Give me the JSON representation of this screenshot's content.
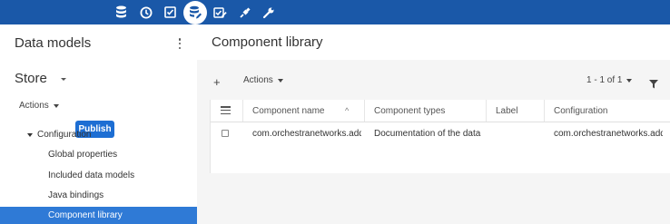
{
  "topbar": {
    "icons": [
      "database-icon",
      "history-icon",
      "checklist-icon",
      "data-model-icon",
      "review-icon",
      "plugin-icon",
      "wrench-icon"
    ],
    "active_icon": "data-model-icon",
    "color": "#1a58a8"
  },
  "sidebar": {
    "title": "Data models",
    "store_label": "Store",
    "actions_label": "Actions",
    "publish_label": "Publish",
    "tree": {
      "configuration_label": "Configuration",
      "items": [
        {
          "label": "Global properties",
          "selected": false
        },
        {
          "label": "Included data models",
          "selected": false
        },
        {
          "label": "Java bindings",
          "selected": false
        },
        {
          "label": "Component library",
          "selected": true
        }
      ]
    },
    "selected_color": "#2f7ad6",
    "publish_color": "#1d6ed3"
  },
  "main": {
    "title": "Component library",
    "toolbar": {
      "add_label": "+",
      "actions_label": "Actions",
      "pagination": "1 - 1 of 1"
    },
    "table": {
      "columns": [
        "Component name",
        "Component types",
        "Label",
        "Configuration"
      ],
      "sort_indicator": "^",
      "rows": [
        [
          "com.orchestranetworks.addo",
          "Documentation of the data m",
          "",
          "com.orchestranetworks.addo"
        ]
      ]
    }
  }
}
